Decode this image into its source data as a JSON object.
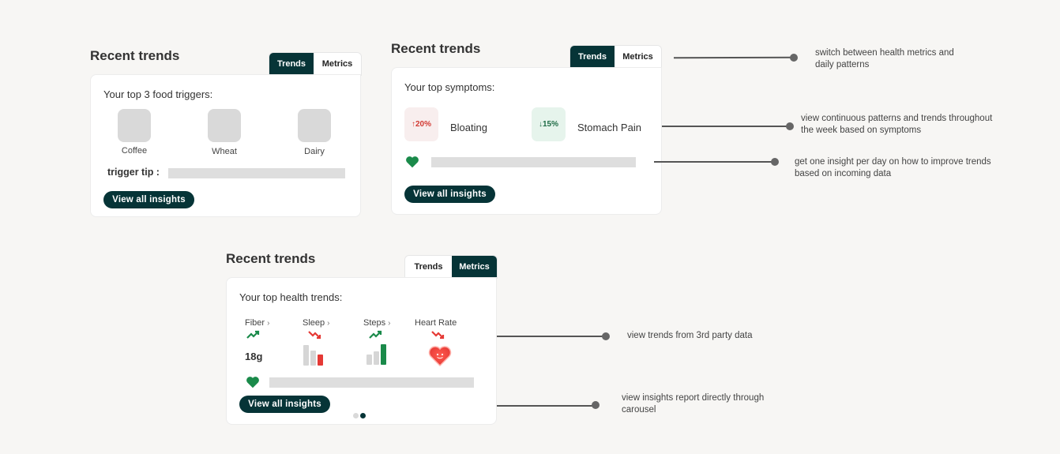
{
  "card1": {
    "title": "Recent trends",
    "tab_trends": "Trends",
    "tab_metrics": "Metrics",
    "heading": "Your top 3 food triggers:",
    "foods": [
      "Coffee",
      "Wheat",
      "Dairy"
    ],
    "tip_label": "trigger tip :",
    "button": "View all insights"
  },
  "card2": {
    "title": "Recent trends",
    "tab_trends": "Trends",
    "tab_metrics": "Metrics",
    "heading": "Your top symptoms:",
    "symptoms": [
      {
        "change": "20%",
        "direction": "up",
        "label": "Bloating",
        "color": "#e53935"
      },
      {
        "change": "15%",
        "direction": "down",
        "label": "Stomach Pain",
        "color": "#1e7a45"
      }
    ],
    "button": "View all insights"
  },
  "card3": {
    "title": "Recent trends",
    "tab_trends": "Trends",
    "tab_metrics": "Metrics",
    "heading": "Your top health trends:",
    "metrics": [
      {
        "label": "Fiber",
        "trend": "up",
        "value": "18g"
      },
      {
        "label": "Sleep",
        "trend": "down"
      },
      {
        "label": "Steps",
        "trend": "up"
      },
      {
        "label": "Heart Rate",
        "trend": "down"
      }
    ],
    "button": "View all insights",
    "carousel_pages": 2,
    "carousel_active": 2
  },
  "annotations": [
    "switch between health metrics and daily patterns",
    "view continuous patterns and trends throughout the week based on symptoms",
    "get one insight per day on how to improve trends based on incoming data",
    "view trends from 3rd party data",
    "view insights report directly through carousel"
  ],
  "colors": {
    "accent": "#063437",
    "heart": "#1a8a4a",
    "down": "#e53935",
    "up": "#1a8a4a"
  }
}
